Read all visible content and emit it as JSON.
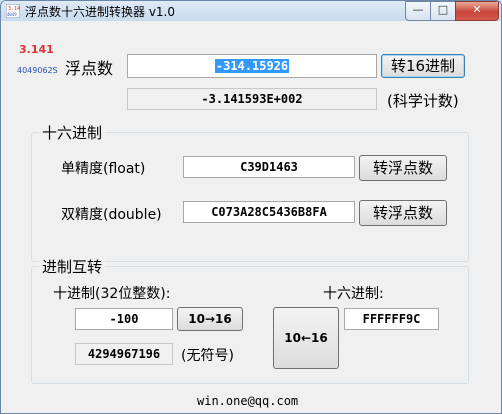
{
  "window": {
    "title": "浮点数十六进制转换器 v1.0",
    "controls": {
      "minimize": "—",
      "maximize": "□",
      "close": "✕"
    }
  },
  "logo": {
    "top": "3.141",
    "bottom": "4049062S"
  },
  "float_section": {
    "label": "浮点数",
    "input_value": "-314.15926",
    "convert_button": "转16进制",
    "sci_value": "-3.141593E+002",
    "sci_label": "(科学计数)"
  },
  "hex_group": {
    "title": "十六进制",
    "single_label": "单精度(float)",
    "single_value": "C39D1463",
    "single_button": "转浮点数",
    "double_label": "双精度(double)",
    "double_value": "C073A28C5436B8FA",
    "double_button": "转浮点数"
  },
  "radix_group": {
    "title": "进制互转",
    "decimal_label": "十进制(32位整数):",
    "decimal_value": "-100",
    "to_hex_button": "10→16",
    "unsigned_value": "4294967196",
    "unsigned_label": "(无符号)",
    "hex_label": "十六进制:",
    "hex_value": "FFFFFF9C",
    "to_dec_button": "10←16"
  },
  "footer": {
    "email": "win.one@qq.com"
  }
}
